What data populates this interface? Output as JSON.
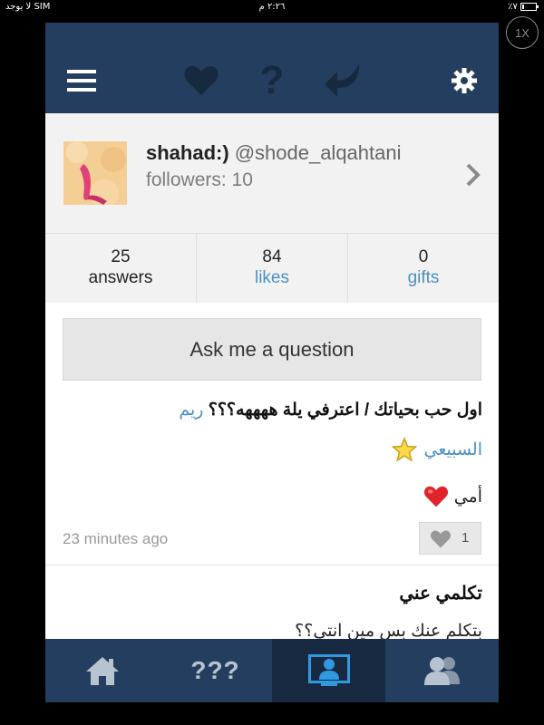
{
  "status_bar": {
    "carrier": "لا يوجد SIM",
    "time": "٢:٢٦ م",
    "battery": "٪٧"
  },
  "zoom_label": "1X",
  "nav": {
    "icons": [
      "menu-icon",
      "heart-icon",
      "question-icon",
      "reply-icon",
      "gear-icon"
    ]
  },
  "profile": {
    "display_name": "shahad:)",
    "username": "@shode_alqahtani",
    "followers": "followers: 10"
  },
  "stats": [
    {
      "number": "25",
      "label": "answers"
    },
    {
      "number": "84",
      "label": "likes"
    },
    {
      "number": "0",
      "label": "gifts"
    }
  ],
  "ask_button": "Ask me a question",
  "feed": {
    "item1": {
      "question": "اول حب بحياتك  /  اعترفي يلة ههههه؟؟؟",
      "asker_first": "ريم",
      "asker_last": "السبيعي",
      "answer": "أمي",
      "time": "23 minutes ago",
      "likes": "1"
    },
    "item2": {
      "question": "تكلمي عني",
      "answer": "بتكلم عنك بس مين انتي؟؟"
    }
  },
  "tabbar": {
    "tab2_text": "???"
  },
  "colors": {
    "nav_bg": "#243e5f",
    "link_blue": "#4a90bf",
    "active_tab": "#172a42"
  }
}
